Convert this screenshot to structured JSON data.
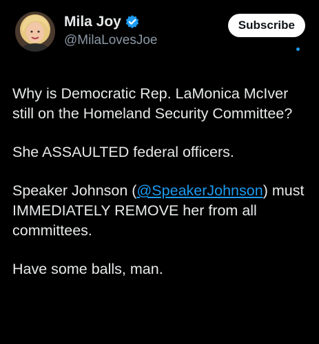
{
  "author": {
    "display_name": "Mila Joy",
    "handle": "@MilaLovesJoe",
    "verified": true
  },
  "actions": {
    "subscribe_label": "Subscribe"
  },
  "post": {
    "p1": "Why is Democratic Rep. LaMonica McIver still on the Homeland Security Committee?",
    "p2": "She ASSAULTED federal officers.",
    "p3_before": "Speaker Johnson (",
    "p3_mention": "@SpeakerJohnson",
    "p3_after": ") must IMMEDIATELY REMOVE her from all committees.",
    "p4": "Have some balls, man."
  },
  "colors": {
    "background": "#000000",
    "text": "#e7e9ea",
    "secondary_text": "#8b98a5",
    "link": "#1d9bf0",
    "verified_badge": "#1d9bf0",
    "subscribe_bg": "#ffffff"
  },
  "icons": {
    "verified": "verified-check-badge-icon",
    "unread": "blue-dot-indicator"
  }
}
